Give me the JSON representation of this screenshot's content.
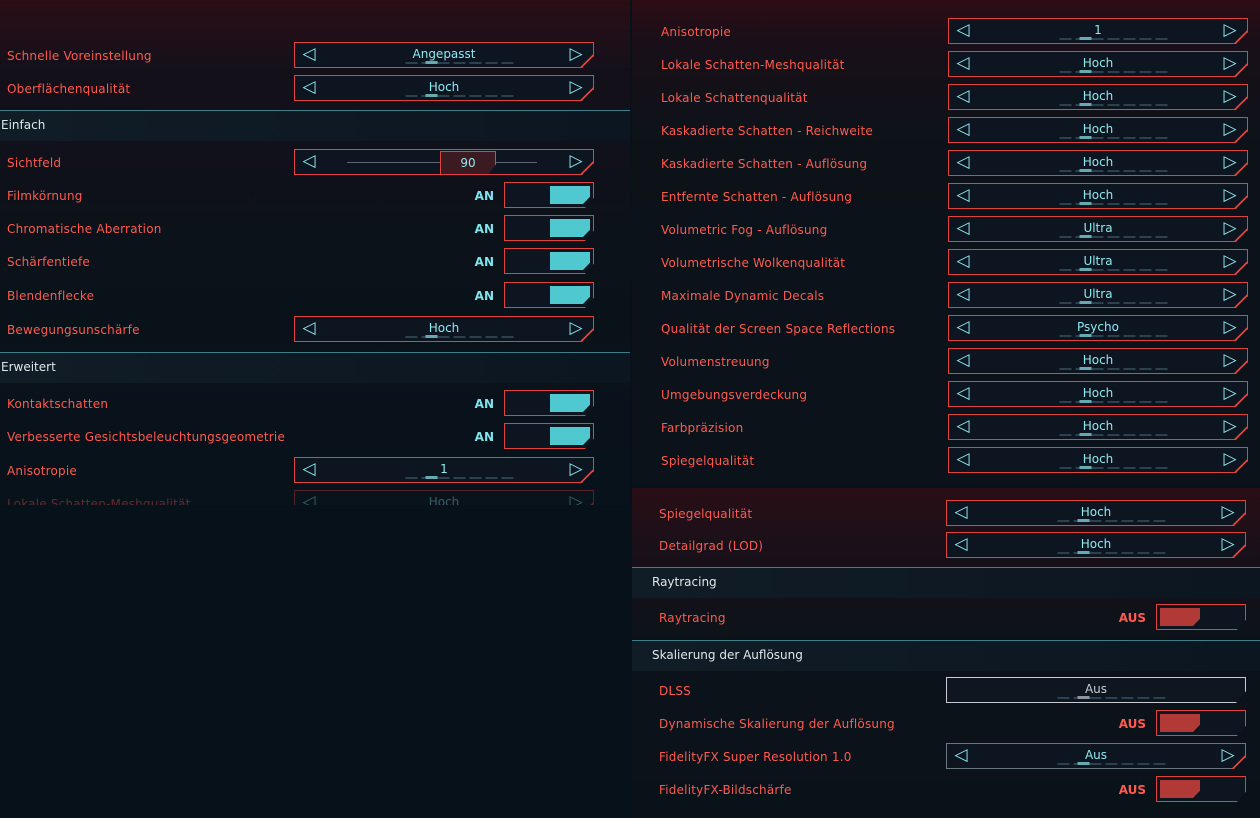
{
  "left_panel": {
    "preset": {
      "label": "Schnelle Voreinstellung",
      "value": "Angepasst"
    },
    "texture": {
      "label": "Oberflächenqualität",
      "value": "Hoch"
    },
    "section_basic": "Einfach",
    "fov": {
      "label": "Sichtfeld",
      "value": "90"
    },
    "film_grain": {
      "label": "Filmkörnung",
      "state": "AN"
    },
    "chromatic": {
      "label": "Chromatische Aberration",
      "state": "AN"
    },
    "dof": {
      "label": "Schärfentiefe",
      "state": "AN"
    },
    "lens_flare": {
      "label": "Blendenflecke",
      "state": "AN"
    },
    "motion_blur": {
      "label": "Bewegungsunschärfe",
      "value": "Hoch"
    },
    "section_advanced": "Erweitert",
    "contact_shadows": {
      "label": "Kontaktschatten",
      "state": "AN"
    },
    "face_lighting": {
      "label": "Verbesserte Gesichtsbeleuchtungsgeometrie",
      "state": "AN"
    },
    "aniso": {
      "label": "Anisotropie",
      "value": "1"
    },
    "local_mesh_partial": {
      "label": "Lokale Schatten-Meshqualität",
      "value": "Hoch"
    }
  },
  "right_top": {
    "rows": [
      {
        "label": "Anisotropie",
        "value": "1"
      },
      {
        "label": "Lokale Schatten-Meshqualität",
        "value": "Hoch"
      },
      {
        "label": "Lokale Schattenqualität",
        "value": "Hoch"
      },
      {
        "label": "Kaskadierte Schatten - Reichweite",
        "value": "Hoch"
      },
      {
        "label": "Kaskadierte Schatten - Auflösung",
        "value": "Hoch"
      },
      {
        "label": "Entfernte Schatten - Auflösung",
        "value": "Hoch"
      },
      {
        "label": "Volumetric Fog - Auflösung",
        "value": "Ultra"
      },
      {
        "label": "Volumetrische Wolkenqualität",
        "value": "Ultra"
      },
      {
        "label": "Maximale Dynamic Decals",
        "value": "Ultra"
      },
      {
        "label": "Qualität der Screen Space Reflections",
        "value": "Psycho"
      },
      {
        "label": "Volumenstreuung",
        "value": "Hoch"
      },
      {
        "label": "Umgebungsverdeckung",
        "value": "Hoch"
      },
      {
        "label": "Farbpräzision",
        "value": "Hoch"
      },
      {
        "label": "Spiegelqualität",
        "value": "Hoch"
      }
    ]
  },
  "right_bottom": {
    "mirror": {
      "label": "Spiegelqualität",
      "value": "Hoch"
    },
    "lod": {
      "label": "Detailgrad (LOD)",
      "value": "Hoch"
    },
    "section_rt": "Raytracing",
    "raytracing": {
      "label": "Raytracing",
      "state": "AUS"
    },
    "section_scaling": "Skalierung der Auflösung",
    "dlss": {
      "label": "DLSS",
      "value": "Aus"
    },
    "dynamic_scaling": {
      "label": "Dynamische Skalierung der Auflösung",
      "state": "AUS"
    },
    "fsr": {
      "label": "FidelityFX Super Resolution 1.0",
      "value": "Aus"
    },
    "cas": {
      "label": "FidelityFX-Bildschärfe",
      "state": "AUS"
    }
  },
  "icons": {
    "left_arrow": "◁",
    "right_arrow": "▷"
  },
  "colors": {
    "label": "#ff5a4f",
    "value": "#8fe9f0",
    "toggle_on": "#50c8d0",
    "toggle_off": "#b13a36",
    "border": "#e0433d"
  }
}
